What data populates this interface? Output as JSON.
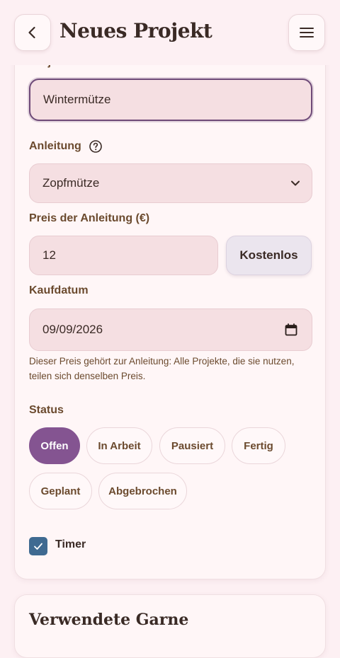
{
  "header": {
    "title": "Neues Projekt",
    "back_icon": "chevron-left-icon",
    "menu_icon": "hamburger-menu-icon"
  },
  "form": {
    "project_name_label": "Projektname",
    "project_name_value": "Wintermütze",
    "pattern_label": "Anleitung",
    "pattern_help_icon": "question-circle-icon",
    "pattern_selected": "Zopfmütze",
    "price_label": "Preis der Anleitung (€)",
    "price_value": "12",
    "free_button_label": "Kostenlos",
    "purchase_date_label": "Kaufdatum",
    "purchase_date_value": "09/09/2026",
    "calendar_icon": "calendar-icon",
    "price_hint": "Dieser Preis gehört zur Anleitung: Alle Projekte, die sie nutzen, teilen sich denselben Preis.",
    "status_label": "Status",
    "status_options": [
      "Offen",
      "In Arbeit",
      "Pausiert",
      "Fertig",
      "Geplant",
      "Abgebrochen"
    ],
    "status_selected": "Offen",
    "timer_label": "Timer",
    "timer_checked": true
  },
  "yarns": {
    "title": "Verwendete Garne"
  },
  "colors": {
    "accent": "#845491",
    "focus_border": "#6e4a78",
    "checkbox": "#3f6a91",
    "background": "#fdf0f3"
  }
}
